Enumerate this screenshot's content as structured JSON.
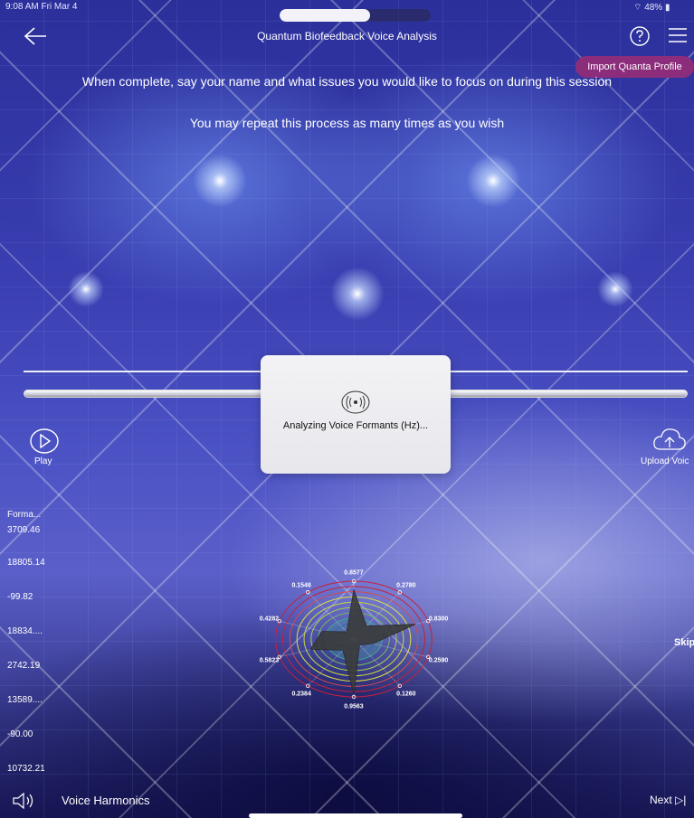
{
  "status_bar": {
    "time": "9:08 AM",
    "date": "Fri Mar 4",
    "battery": "48%",
    "progress": 0.6
  },
  "nav": {
    "title": "Quantum Biofeedback Voice Analysis",
    "import_label": "Import Quanta Profile"
  },
  "instructions": {
    "line1": "When complete, say your name and what issues you would like to focus on during this session",
    "line2": "You may repeat this process as many times as you wish"
  },
  "modal": {
    "text": "Analyzing Voice Formants (Hz)..."
  },
  "controls": {
    "play_label": "Play",
    "upload_label": "Upload Voic",
    "skip_label": "Skip"
  },
  "formants": {
    "header": "Forma...",
    "values": [
      "3709.46",
      "18805.14",
      "-99.82",
      "18834....",
      "2742.19",
      "13589....",
      "-90.00",
      "10732.21"
    ]
  },
  "chart_data": {
    "type": "radar",
    "categories": [
      "top",
      "top-right",
      "right-upper",
      "right-lower",
      "bottom-right",
      "bottom",
      "bottom-left",
      "left-lower",
      "left-upper",
      "top-left"
    ],
    "values": [
      0.8577,
      0.278,
      0.83,
      0.259,
      0.126,
      0.9563,
      0.2384,
      0.5823,
      0.4282,
      0.1546
    ],
    "value_labels": [
      "0.8577",
      "0.2780",
      "0.8300",
      "0.2590",
      "0.1260",
      "0.9563",
      "0.2384",
      "0.5823",
      "0.4282",
      "0.1546"
    ],
    "rmax": 1,
    "shape_color": "#3a3a3a",
    "ring_colors": [
      "#c8203a",
      "#c8203a",
      "#d84a4a",
      "#e0e040",
      "#c8d840",
      "#a8d050",
      "#70b860",
      "#40a0a0",
      "#4060c0",
      "#5040b0",
      "#6040a0"
    ]
  },
  "bottom": {
    "voice_harmonics": "Voice Harmonics",
    "next_label": "Next"
  },
  "colors": {
    "accent_import": "#8b2d7a"
  }
}
